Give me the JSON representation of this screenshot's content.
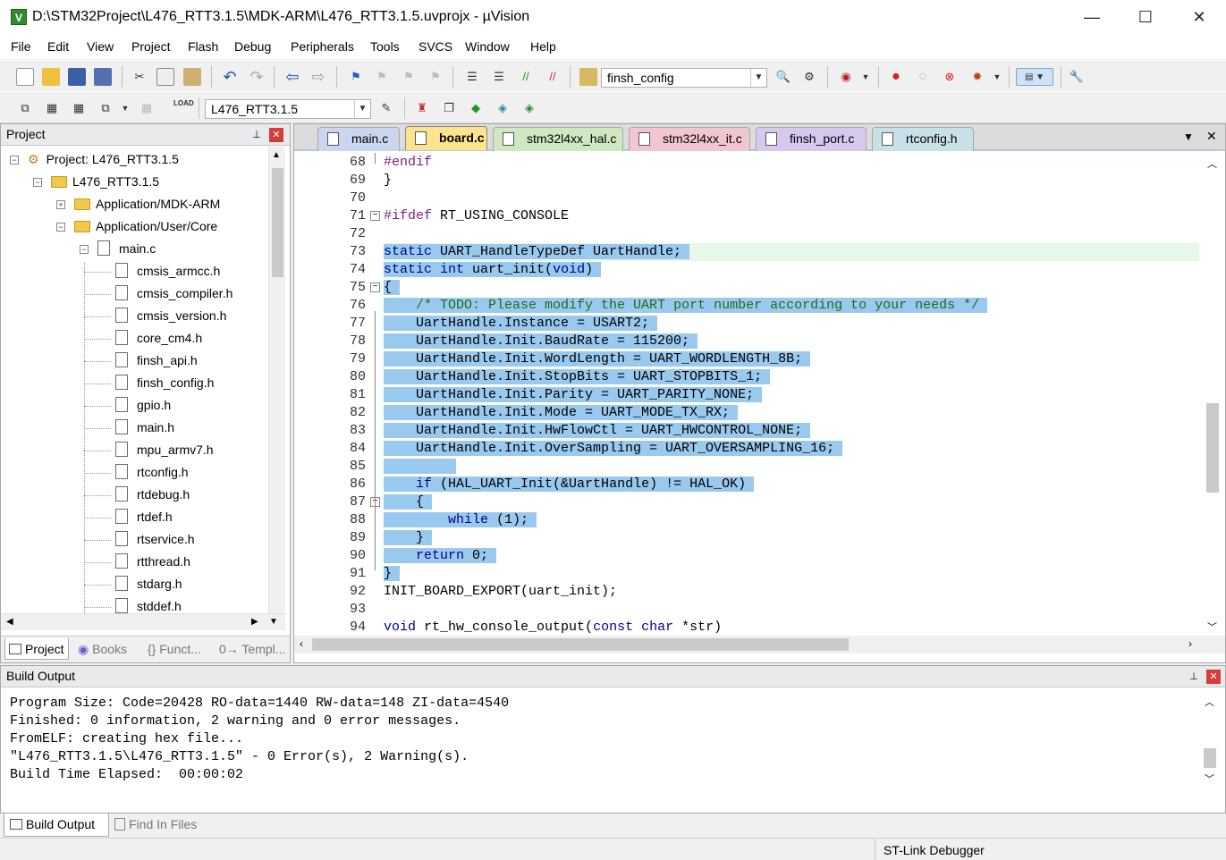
{
  "window": {
    "title": "D:\\STM32Project\\L476_RTT3.1.5\\MDK-ARM\\L476_RTT3.1.5.uvprojx - µVision",
    "app_icon_letter": "V",
    "minimize": "—",
    "maximize": "☐",
    "close": "✕"
  },
  "menu": [
    "File",
    "Edit",
    "View",
    "Project",
    "Flash",
    "Debug",
    "Peripherals",
    "Tools",
    "SVCS",
    "Window",
    "Help"
  ],
  "toolbar1": {
    "target_combo_value": "finsh_config"
  },
  "toolbar2": {
    "project_combo_value": "L476_RTT3.1.5"
  },
  "project_panel": {
    "title": "Project",
    "pin": "⊥",
    "close": "✕",
    "tree": [
      {
        "label": "Project: L476_RTT3.1.5",
        "kind": "root",
        "level": 0,
        "expander": "−"
      },
      {
        "label": "L476_RTT3.1.5",
        "kind": "folder",
        "level": 1,
        "expander": "−"
      },
      {
        "label": "Application/MDK-ARM",
        "kind": "folder",
        "level": 2,
        "expander": "+"
      },
      {
        "label": "Application/User/Core",
        "kind": "folder",
        "level": 2,
        "expander": "−"
      },
      {
        "label": "main.c",
        "kind": "file",
        "level": 3,
        "expander": "−"
      },
      {
        "label": "cmsis_armcc.h",
        "kind": "file",
        "level": 4
      },
      {
        "label": "cmsis_compiler.h",
        "kind": "file",
        "level": 4
      },
      {
        "label": "cmsis_version.h",
        "kind": "file",
        "level": 4
      },
      {
        "label": "core_cm4.h",
        "kind": "file",
        "level": 4
      },
      {
        "label": "finsh_api.h",
        "kind": "file",
        "level": 4
      },
      {
        "label": "finsh_config.h",
        "kind": "file",
        "level": 4
      },
      {
        "label": "gpio.h",
        "kind": "file",
        "level": 4
      },
      {
        "label": "main.h",
        "kind": "file",
        "level": 4
      },
      {
        "label": "mpu_armv7.h",
        "kind": "file",
        "level": 4
      },
      {
        "label": "rtconfig.h",
        "kind": "file",
        "level": 4
      },
      {
        "label": "rtdebug.h",
        "kind": "file",
        "level": 4
      },
      {
        "label": "rtdef.h",
        "kind": "file",
        "level": 4
      },
      {
        "label": "rtservice.h",
        "kind": "file",
        "level": 4
      },
      {
        "label": "rtthread.h",
        "kind": "file",
        "level": 4
      },
      {
        "label": "stdarg.h",
        "kind": "file",
        "level": 4
      },
      {
        "label": "stddef.h",
        "kind": "file",
        "level": 4
      }
    ],
    "tabs": [
      "Project",
      "Books",
      "{} Funct...",
      "0→ Templ..."
    ]
  },
  "editor": {
    "tabs": [
      {
        "label": "main.c",
        "color": "#c9d6ee"
      },
      {
        "label": "board.c",
        "color": "#fce48c",
        "active": true
      },
      {
        "label": "stm32l4xx_hal.c",
        "color": "#cfe8c0"
      },
      {
        "label": "stm32l4xx_it.c",
        "color": "#f2c6d0"
      },
      {
        "label": "finsh_port.c",
        "color": "#d8c8ee"
      },
      {
        "label": "rtconfig.h",
        "color": "#c8e0e8"
      }
    ],
    "tab_menu": "▼",
    "tab_close": "✕",
    "lines": [
      {
        "n": "68",
        "t": "#endif"
      },
      {
        "n": "69",
        "t": "}"
      },
      {
        "n": "70",
        "t": ""
      },
      {
        "n": "71",
        "t": "#ifdef RT_USING_CONSOLE"
      },
      {
        "n": "72",
        "t": ""
      },
      {
        "n": "73",
        "t": "static UART_HandleTypeDef UartHandle;"
      },
      {
        "n": "74",
        "t": "static int uart_init(void)"
      },
      {
        "n": "75",
        "t": "{"
      },
      {
        "n": "76",
        "t": "    /* TODO: Please modify the UART port number according to your needs */"
      },
      {
        "n": "77",
        "t": "    UartHandle.Instance = USART2;"
      },
      {
        "n": "78",
        "t": "    UartHandle.Init.BaudRate = 115200;"
      },
      {
        "n": "79",
        "t": "    UartHandle.Init.WordLength = UART_WORDLENGTH_8B;"
      },
      {
        "n": "80",
        "t": "    UartHandle.Init.StopBits = UART_STOPBITS_1;"
      },
      {
        "n": "81",
        "t": "    UartHandle.Init.Parity = UART_PARITY_NONE;"
      },
      {
        "n": "82",
        "t": "    UartHandle.Init.Mode = UART_MODE_TX_RX;"
      },
      {
        "n": "83",
        "t": "    UartHandle.Init.HwFlowCtl = UART_HWCONTROL_NONE;"
      },
      {
        "n": "84",
        "t": "    UartHandle.Init.OverSampling = UART_OVERSAMPLING_16;"
      },
      {
        "n": "85",
        "t": ""
      },
      {
        "n": "86",
        "t": "    if (HAL_UART_Init(&UartHandle) != HAL_OK)"
      },
      {
        "n": "87",
        "t": "    {"
      },
      {
        "n": "88",
        "t": "        while (1);"
      },
      {
        "n": "89",
        "t": "    }"
      },
      {
        "n": "90",
        "t": "    return 0;"
      },
      {
        "n": "91",
        "t": "}"
      },
      {
        "n": "92",
        "t": "INIT_BOARD_EXPORT(uart_init);"
      },
      {
        "n": "93",
        "t": ""
      },
      {
        "n": "94",
        "t": "void rt_hw_console_output(const char *str)"
      }
    ]
  },
  "build_output": {
    "title": "Build Output",
    "pin": "⊥",
    "close": "✕",
    "lines": [
      "Program Size: Code=20428 RO-data=1440 RW-data=148 ZI-data=4540",
      "Finished: 0 information, 2 warning and 0 error messages.",
      "FromELF: creating hex file...",
      "\"L476_RTT3.1.5\\L476_RTT3.1.5\" - 0 Error(s), 2 Warning(s).",
      "Build Time Elapsed:  00:00:02"
    ],
    "tabs": [
      "Build Output",
      "Find In Files"
    ]
  },
  "status": {
    "debugger": "ST-Link Debugger"
  }
}
